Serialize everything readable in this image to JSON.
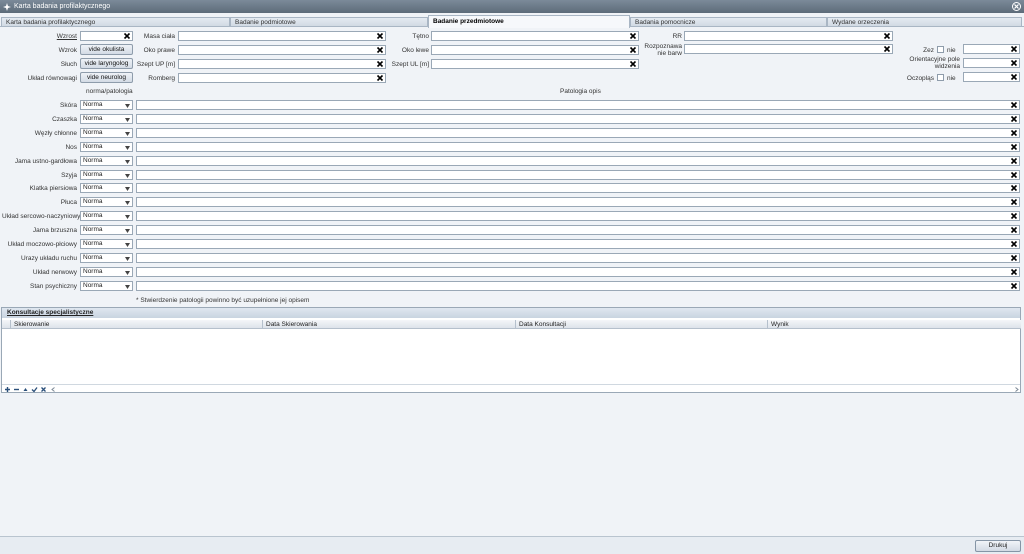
{
  "window": {
    "title": "Karta badania profilaktycznego"
  },
  "tabs": [
    {
      "label": "Karta badania profilaktycznego"
    },
    {
      "label": "Badanie podmiotowe"
    },
    {
      "label": "Badanie przedmiotowe"
    },
    {
      "label": "Badania pomocnicze"
    },
    {
      "label": "Wydane orzeczenia"
    }
  ],
  "top_fields": {
    "wzrost": "Wzrost",
    "wzrok": "Wzrok",
    "sluch": "Słuch",
    "uklad_rownowagi": "Układ równowagi",
    "vide_okulista": "vide okulista",
    "vide_laryngolog": "vide laryngolog",
    "vide_neurolog": "vide neurolog",
    "masa_ciala": "Masa ciała",
    "oko_prawe": "Oko prawe",
    "szept_up": "Szept UP [m]",
    "romberg": "Romberg",
    "tetno": "Tętno",
    "oko_lewe": "Oko lewe",
    "szept_ul": "Szept UL [m]",
    "rr": "RR",
    "rozpoznawa_line1": "Rozpoznawa",
    "rozpoznawa_line2": "nie barw",
    "zez": "Zez",
    "oczoplas": "Oczopląs",
    "nie1": "nie",
    "nie2": "nie",
    "orient_line1": "Orientacyjne pole",
    "orient_line2": "widzenia"
  },
  "exam": {
    "header_norm": "norma/patologia",
    "header_opis": "Patologia opis",
    "rows": [
      {
        "label": "Skóra",
        "value": "Norma"
      },
      {
        "label": "Czaszka",
        "value": "Norma"
      },
      {
        "label": "Węzły chłonne",
        "value": "Norma"
      },
      {
        "label": "Nos",
        "value": "Norma"
      },
      {
        "label": "Jama ustno-gardłowa",
        "value": "Norma"
      },
      {
        "label": "Szyja",
        "value": "Norma"
      },
      {
        "label": "Klatka piersiowa",
        "value": "Norma"
      },
      {
        "label": "Płuca",
        "value": "Norma"
      },
      {
        "label": "Układ sercowo-naczyniowy",
        "value": "Norma"
      },
      {
        "label": "Jama brzuszna",
        "value": "Norma"
      },
      {
        "label": "Układ moczowo-płciowy",
        "value": "Norma"
      },
      {
        "label": "Urazy układu ruchu",
        "value": "Norma"
      },
      {
        "label": "Układ nerwowy",
        "value": "Norma"
      },
      {
        "label": "Stan psychiczny",
        "value": "Norma"
      }
    ],
    "note": "* Stwierdzenie patologii powinno być uzupełnione jej opisem"
  },
  "consult": {
    "title": "Konsultacje specjalistyczne",
    "columns": [
      "Skierowanie",
      "Data Skierowania",
      "Data Konsultacji",
      "Wynik"
    ]
  },
  "print_label": "Drukuj"
}
